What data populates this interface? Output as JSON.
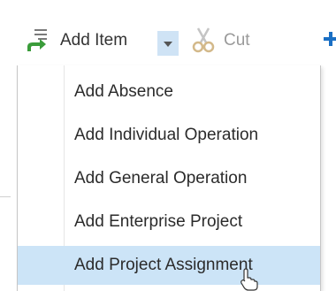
{
  "toolbar": {
    "add_item": {
      "label": "Add Item",
      "icon": "add-item-arrow-icon"
    },
    "dropdown": {
      "icon": "chevron-down-icon"
    },
    "cut": {
      "label": "Cut",
      "icon": "scissors-icon",
      "disabled": true
    },
    "next_icon": "plus-icon"
  },
  "menu": {
    "items": [
      {
        "label": "Add Absence",
        "selected": false
      },
      {
        "label": "Add Individual Operation",
        "selected": false
      },
      {
        "label": "Add General Operation",
        "selected": false
      },
      {
        "label": "Add Enterprise Project",
        "selected": false
      },
      {
        "label": "Add Project Assignment",
        "selected": true
      }
    ]
  },
  "colors": {
    "selection": "#cce4f7",
    "dropdown_bg": "#cfe3f5",
    "accent_blue": "#1a6fc4",
    "accent_green": "#3a9c3a"
  }
}
